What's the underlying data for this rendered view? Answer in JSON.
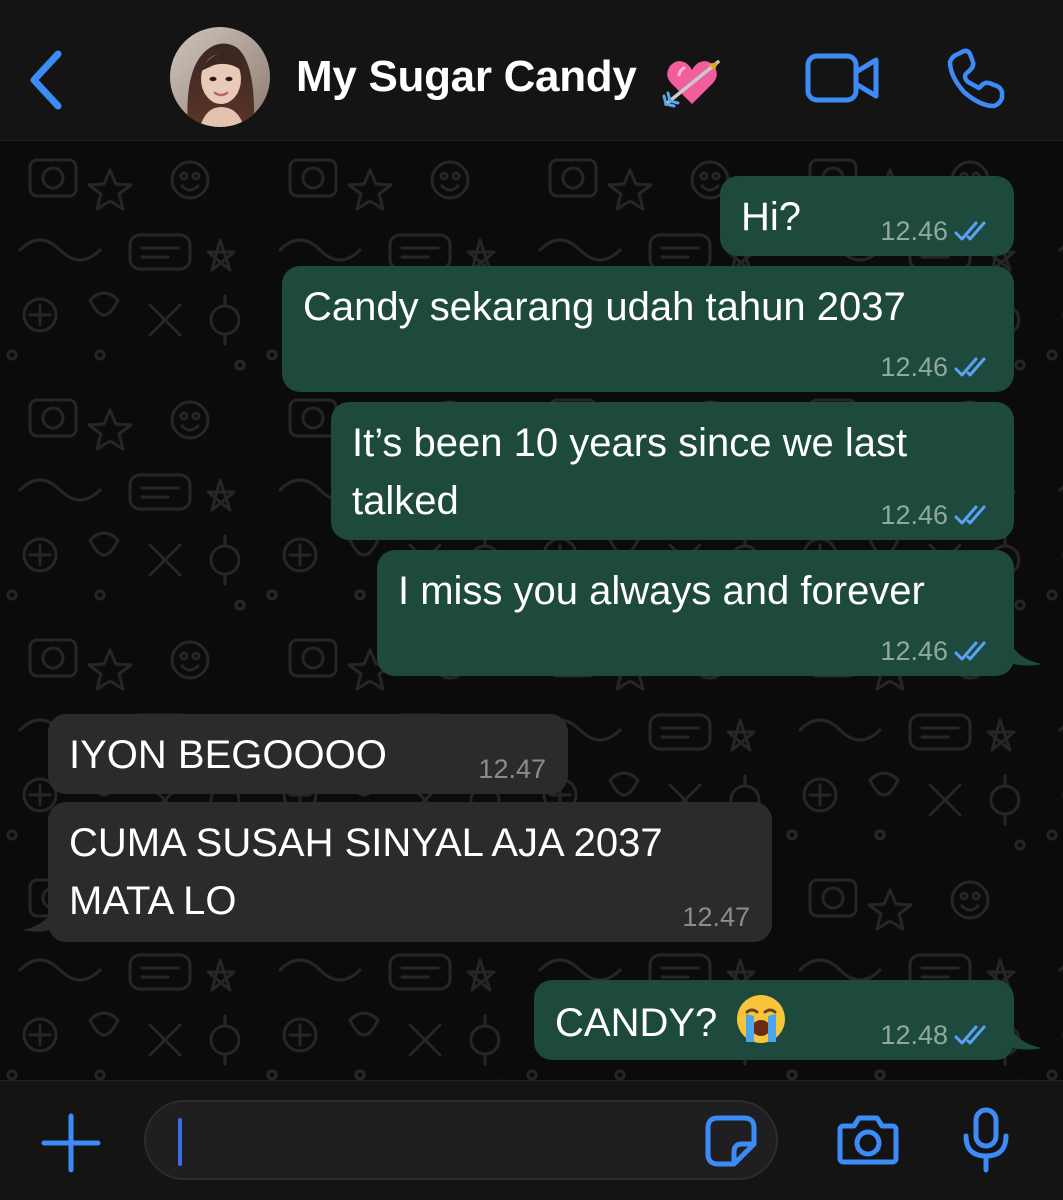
{
  "header": {
    "contact_name": "My Sugar Candy",
    "status_emoji": "heart-with-arrow-emoji",
    "avatar_icon": "contact-photo",
    "back_icon": "chevron-left-icon",
    "video_icon": "video-camera-icon",
    "call_icon": "phone-icon"
  },
  "messages": [
    {
      "direction": "outgoing",
      "lines": [
        "Hi?"
      ],
      "time": "12.46",
      "status": "read"
    },
    {
      "direction": "outgoing",
      "lines": [
        "Candy sekarang udah tahun 2037"
      ],
      "time": "12.46",
      "status": "read"
    },
    {
      "direction": "outgoing",
      "lines": [
        "It’s been 10 years since we last",
        "talked"
      ],
      "time": "12.46",
      "status": "read"
    },
    {
      "direction": "outgoing",
      "lines": [
        "I miss you always and forever"
      ],
      "time": "12.46",
      "status": "read"
    },
    {
      "direction": "incoming",
      "lines": [
        "IYON BEGOOOO"
      ],
      "time": "12.47"
    },
    {
      "direction": "incoming",
      "lines": [
        "CUMA SUSAH SINYAL AJA 2037",
        "MATA LO"
      ],
      "time": "12.47"
    },
    {
      "direction": "outgoing",
      "lines": [
        "CANDY?"
      ],
      "emoji": "loudly-crying-face-emoji",
      "time": "12.48",
      "status": "read"
    }
  ],
  "input_bar": {
    "plus_icon": "plus-icon",
    "message_value": "",
    "sticker_icon": "sticker-icon",
    "camera_icon": "camera-icon",
    "mic_icon": "microphone-icon"
  },
  "colors": {
    "accent": "#3d8bf7",
    "outgoing_bubble": "#1d4a3c",
    "incoming_bubble": "#2b2b2d",
    "read_ticks": "#5aa2f5",
    "background": "#0b0b0b"
  }
}
